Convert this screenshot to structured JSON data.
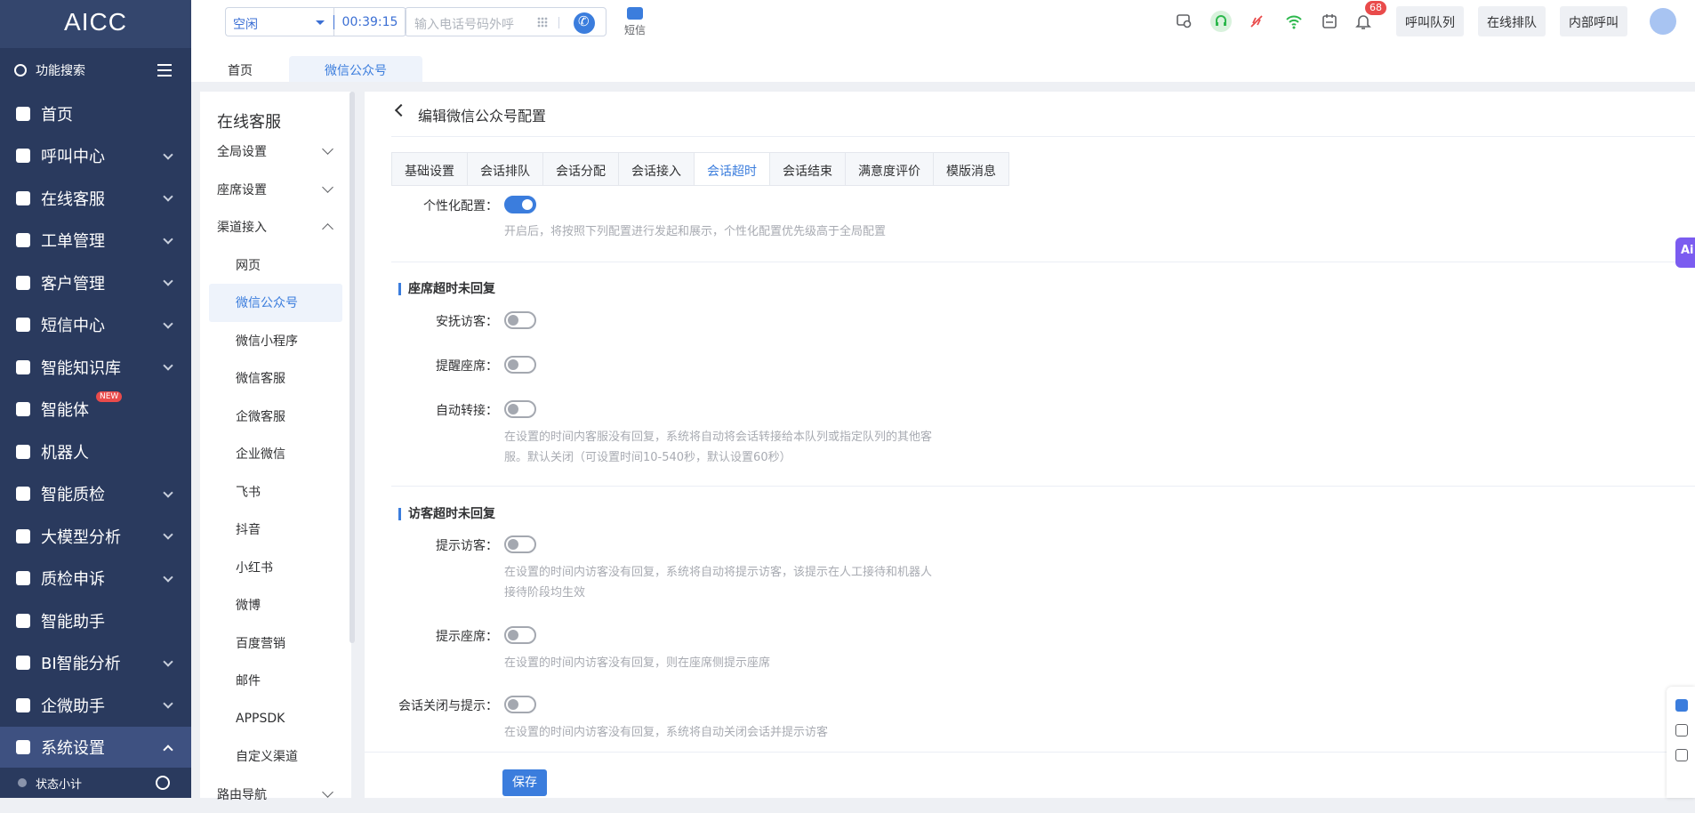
{
  "app": {
    "logo": "AICC"
  },
  "sidebar": {
    "search_label": "功能搜索",
    "items": [
      {
        "label": "首页",
        "icon": "home-icon",
        "expandable": false
      },
      {
        "label": "呼叫中心",
        "icon": "phone-icon",
        "expandable": true
      },
      {
        "label": "在线客服",
        "icon": "chat-icon",
        "expandable": true
      },
      {
        "label": "工单管理",
        "icon": "clipboard-icon",
        "expandable": true
      },
      {
        "label": "客户管理",
        "icon": "users-icon",
        "expandable": true
      },
      {
        "label": "短信中心",
        "icon": "mail-icon",
        "expandable": true
      },
      {
        "label": "智能知识库",
        "icon": "library-icon",
        "expandable": true
      },
      {
        "label": "智能体",
        "icon": "apps-icon",
        "expandable": false,
        "badge": "NEW"
      },
      {
        "label": "机器人",
        "icon": "robot-icon",
        "expandable": false
      },
      {
        "label": "智能质检",
        "icon": "check-chart-icon",
        "expandable": true
      },
      {
        "label": "大模型分析",
        "icon": "trend-icon",
        "expandable": true
      },
      {
        "label": "质检申诉",
        "icon": "shield-check-icon",
        "expandable": true
      },
      {
        "label": "智能助手",
        "icon": "assistant-icon",
        "expandable": false
      },
      {
        "label": "BI智能分析",
        "icon": "pie-icon",
        "expandable": true
      },
      {
        "label": "企微助手",
        "icon": "wecom-icon",
        "expandable": true
      },
      {
        "label": "系统设置",
        "icon": "grid-icon",
        "expandable": true,
        "active": true
      }
    ],
    "footer_label": "状态小计"
  },
  "topbar": {
    "status": "空闲",
    "timer": "00:39:15",
    "dial_placeholder": "输入电话号码外呼",
    "sms_label": "短信",
    "notification_count": "68",
    "buttons": [
      "呼叫队列",
      "在线排队",
      "内部呼叫"
    ]
  },
  "tabs": [
    {
      "label": "首页",
      "active": false
    },
    {
      "label": "微信公众号",
      "active": true
    }
  ],
  "submenu": {
    "title": "在线客服",
    "groups": [
      {
        "label": "全局设置",
        "expanded": false
      },
      {
        "label": "座席设置",
        "expanded": false
      },
      {
        "label": "渠道接入",
        "expanded": true
      }
    ],
    "channels": [
      "网页",
      "微信公众号",
      "微信小程序",
      "微信客服",
      "企微客服",
      "企业微信",
      "飞书",
      "抖音",
      "小红书",
      "微博",
      "百度营销",
      "邮件",
      "APPSDK",
      "自定义渠道"
    ],
    "selected": "微信公众号",
    "next_group": "路由导航"
  },
  "main": {
    "title": "编辑微信公众号配置",
    "config_tabs": [
      "基础设置",
      "会话排队",
      "会话分配",
      "会话接入",
      "会话超时",
      "会话结束",
      "满意度评价",
      "模版消息"
    ],
    "active_tab": "会话超时",
    "personalize": {
      "label": "个性化配置：",
      "on": true,
      "hint": "开启后，将按照下列配置进行发起和展示，个性化配置优先级高于全局配置"
    },
    "section1": {
      "title": "座席超时未回复",
      "rows": [
        {
          "label": "安抚访客：",
          "on": false
        },
        {
          "label": "提醒座席：",
          "on": false
        },
        {
          "label": "自动转接：",
          "on": false
        }
      ],
      "hint_line1": "在设置的时间内客服没有回复，系统将自动将会话转接给本队列或指定队列的其他客",
      "hint_line2": "服。默认关闭（可设置时间10-540秒，默认设置60秒）"
    },
    "section2": {
      "title": "访客超时未回复",
      "rows": [
        {
          "label": "提示访客：",
          "on": false,
          "hint1": "在设置的时间内访客没有回复，系统将自动将提示访客，该提示在人工接待和机器人",
          "hint2": "接待阶段均生效"
        },
        {
          "label": "提示座席：",
          "on": false,
          "hint1": "在设置的时间内访客没有回复，则在座席侧提示座席"
        },
        {
          "label": "会话关闭与提示：",
          "on": false,
          "hint1": "在设置的时间内访客没有回复，系统将自动关闭会话并提示访客"
        }
      ]
    },
    "save_label": "保存"
  },
  "floating": {
    "ai_label": "Ai"
  }
}
